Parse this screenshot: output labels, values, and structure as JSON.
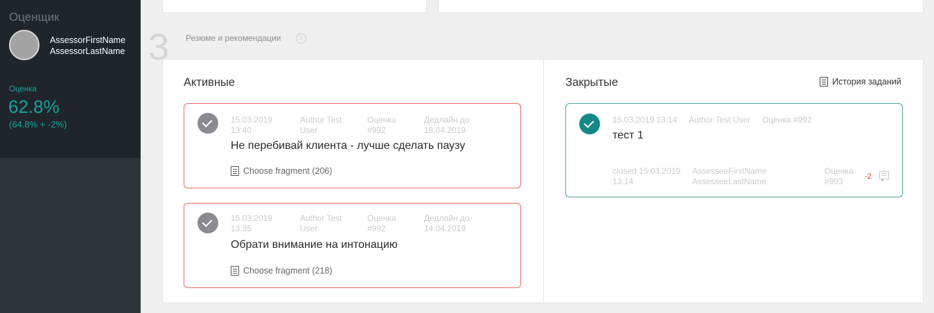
{
  "sidebar": {
    "role_title": "Оценщик",
    "assessor_first": "AssessorFirstName",
    "assessor_last": "AssessorLastName",
    "score_label": "Оценка",
    "score_value": "62.8%",
    "score_detail": "(64.8% + -2%)"
  },
  "section": {
    "number": "3",
    "title": "Резюме и рекомендации",
    "info_icon": "info-icon"
  },
  "active": {
    "title": "Активные",
    "cards": [
      {
        "date": "15.03.2019",
        "time": "13:40",
        "author_line1": "Author Test",
        "author_line2": "User",
        "grade_line1": "Оценка",
        "grade_line2": "#992",
        "deadline_line1": "Дедлайн до",
        "deadline_line2": "18.04.2019",
        "text": "Не перебивай клиента - лучше сделать паузу",
        "fragment": "Choose fragment (206)"
      },
      {
        "date": "15.03.2019",
        "time": "13:35",
        "author_line1": "Author Test",
        "author_line2": "User",
        "grade_line1": "Оценка",
        "grade_line2": "#992",
        "deadline_line1": "Дедлайн до",
        "deadline_line2": "14.04.2019",
        "text": "Обрати внимание на интонацию",
        "fragment": "Choose fragment (218)"
      }
    ]
  },
  "closed": {
    "title": "Закрытые",
    "history_link": "История заданий",
    "cards": [
      {
        "datetime": "15.03.2019 13:14",
        "author": "Author Test User",
        "grade": "Оценка #992",
        "text": "тест 1",
        "closed_line1": "closed 15.03.2019",
        "closed_line2": "13:14",
        "assessee_first": "AssesseeFirstName",
        "assessee_last": "AssesseeLastName",
        "grade2_line1": "Оценка",
        "grade2_line2": "#993",
        "delta": "-2"
      }
    ]
  },
  "colors": {
    "sidebar": "#2e333a",
    "accent_teal": "#19a39a",
    "active_border": "#ea6a6a",
    "closed_border": "#4ea9a5"
  }
}
